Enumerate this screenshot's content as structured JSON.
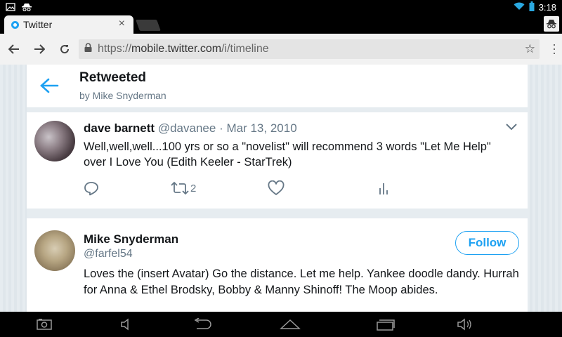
{
  "status_bar": {
    "time": "3:18",
    "icons": [
      "gallery-icon",
      "incognito-icon",
      "wifi-icon",
      "battery-icon"
    ]
  },
  "browser": {
    "tab": {
      "title": "Twitter",
      "close_label": "×"
    },
    "url": {
      "scheme": "https://",
      "host": "mobile.twitter.com",
      "path": "/i/timeline"
    },
    "toolbar_icons": [
      "back-icon",
      "forward-icon",
      "reload-icon",
      "lock-icon",
      "star-icon",
      "menu-icon"
    ]
  },
  "header": {
    "title": "Retweeted",
    "subtitle": "by Mike Snyderman"
  },
  "tweet": {
    "name": "dave barnett",
    "handle": "@davanee",
    "separator": "·",
    "date": "Mar 13, 2010",
    "text": "Well,well,well...100 yrs or so a \"novelist\" will recommend 3 words \"Let Me Help\" over I Love You (Edith Keeler - StarTrek)",
    "retweet_count": "2"
  },
  "user": {
    "name": "Mike Snyderman",
    "handle": "@farfel54",
    "follow_label": "Follow",
    "bio": "Loves the (insert Avatar) Go the distance. Let me help. Yankee doodle dandy. Hurrah for Anna & Ethel Brodsky, Bobby & Manny Shinoff! The Moop abides."
  },
  "colors": {
    "accent": "#1da1f2",
    "text_primary": "#14171a",
    "text_secondary": "#657786",
    "page_bg": "#e6ecf0"
  }
}
